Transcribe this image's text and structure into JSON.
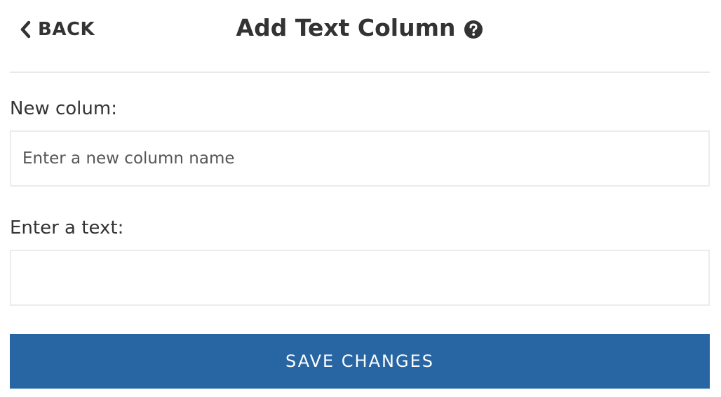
{
  "header": {
    "back_label": "BACK",
    "title": "Add Text Column",
    "help_icon": "question-circle-icon"
  },
  "form": {
    "column_label": "New colum:",
    "column_placeholder": "Enter a new column name",
    "column_value": "",
    "text_label": "Enter a text:",
    "text_placeholder": "",
    "text_value": ""
  },
  "actions": {
    "save_label": "SAVE CHANGES"
  },
  "colors": {
    "primary": "#2765a3",
    "text": "#333333",
    "border": "#ececec"
  }
}
